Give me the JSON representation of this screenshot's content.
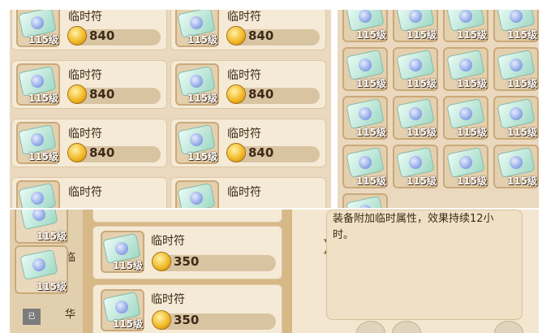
{
  "item": {
    "name": "临时符",
    "level": "115级"
  },
  "shop_top": {
    "price": "840",
    "rows": 4
  },
  "shop_bottom": {
    "price": "350"
  },
  "side": {
    "chars": [
      "临",
      "华"
    ],
    "seal": "已"
  },
  "description": "装备附加临时属性，效果持续12小时。",
  "colors": {
    "panel": "#ead9bf",
    "card": "#f5ead6",
    "coin": "#f0b520",
    "text": "#3d2a17"
  },
  "icons": [
    "talisman-icon",
    "coin-icon",
    "arrow-right-icon"
  ]
}
